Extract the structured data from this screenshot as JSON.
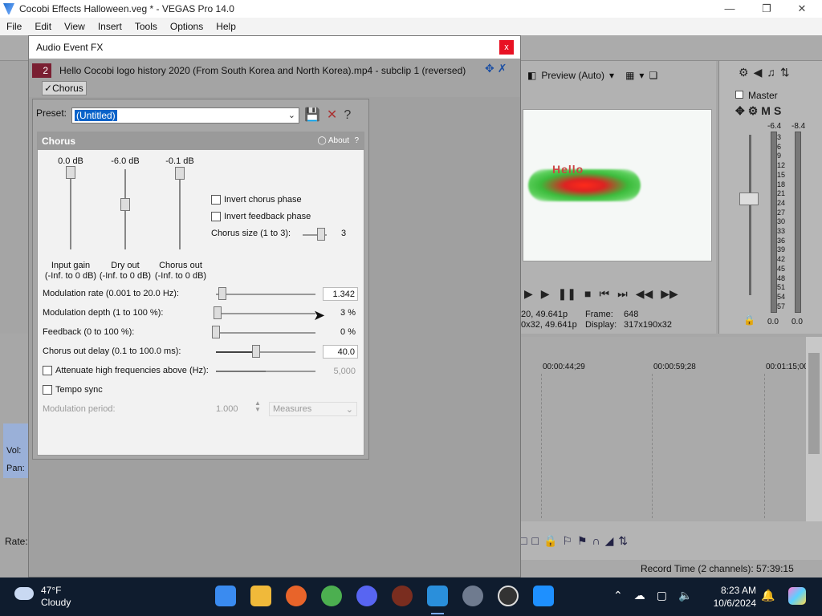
{
  "window": {
    "title": "Cocobi Effects Halloween.veg * - VEGAS Pro 14.0"
  },
  "menu": [
    "File",
    "Edit",
    "View",
    "Insert",
    "Tools",
    "Options",
    "Help"
  ],
  "dialog": {
    "title": "Audio Event FX",
    "close_label": "x",
    "chain_number": "2",
    "chain_title": "Hello Cocobi logo history 2020 (From South Korea and North Korea).mp4 - subclip 1 (reversed)",
    "chain_tab": "Chorus"
  },
  "preset": {
    "label": "Preset:",
    "value": "(Untitled)"
  },
  "chorus": {
    "header": "Chorus",
    "about": "About",
    "help": "?",
    "faders": [
      {
        "value": "0.0 dB",
        "label1": "Input gain",
        "label2": "(-Inf. to 0 dB)",
        "level": 1.0
      },
      {
        "value": "-6.0 dB",
        "label1": "Dry out",
        "label2": "(-Inf. to 0 dB)",
        "level": 0.6
      },
      {
        "value": "-0.1 dB",
        "label1": "Chorus out",
        "label2": "(-Inf. to 0 dB)",
        "level": 0.99
      }
    ],
    "invert_chorus": "Invert chorus phase",
    "invert_feedback": "Invert feedback phase",
    "chorus_size_label": "Chorus size (1 to 3):",
    "chorus_size_value": "3",
    "params": [
      {
        "label": "Modulation rate (0.001 to 20.0 Hz):",
        "value": "1.342",
        "fraction": 0.067
      },
      {
        "label": "Modulation depth (1 to 100 %):",
        "value": "3 %",
        "fraction": 0.02
      },
      {
        "label": "Feedback (0 to 100 %):",
        "value": "0 %",
        "fraction": 0.0
      },
      {
        "label": "Chorus out delay (0.1 to 100.0 ms):",
        "value": "40.0",
        "fraction": 0.4
      },
      {
        "label": "Attenuate high frequencies above (Hz):",
        "value": "5,000",
        "fraction": 0.5
      }
    ],
    "tempo_sync": "Tempo sync",
    "mod_period_label": "Modulation period:",
    "mod_period_value": "1.000",
    "mod_period_unit": "Measures"
  },
  "preview": {
    "mode": "Preview (Auto)",
    "logo_text": "Hello",
    "info": {
      "res1": "20, 49.641p",
      "res2": "0x32, 49.641p",
      "frame_label": "Frame:",
      "frame_value": "648",
      "display_label": "Display:",
      "display_value": "317x190x32"
    }
  },
  "master": {
    "label": "Master",
    "db_left": "-6.4",
    "db_right": "-8.4",
    "scale": [
      "3",
      "6",
      "9",
      "12",
      "15",
      "18",
      "21",
      "24",
      "27",
      "30",
      "33",
      "36",
      "39",
      "42",
      "45",
      "48",
      "51",
      "54",
      "57"
    ],
    "bottom_left": "0.0",
    "bottom_right": "0.0"
  },
  "timeline": {
    "ticks": [
      "00:00:44;29",
      "00:00:59;28",
      "00:01:15;00"
    ]
  },
  "status": {
    "record_time": "Record Time (2 channels): 57:39:15"
  },
  "left": {
    "rate_label": "Rate:",
    "vol_label": "Vol:",
    "pan_label": "Pan:"
  },
  "taskbar": {
    "temperature": "47°F",
    "condition": "Cloudy",
    "time": "8:23 AM",
    "date": "10/6/2024"
  }
}
